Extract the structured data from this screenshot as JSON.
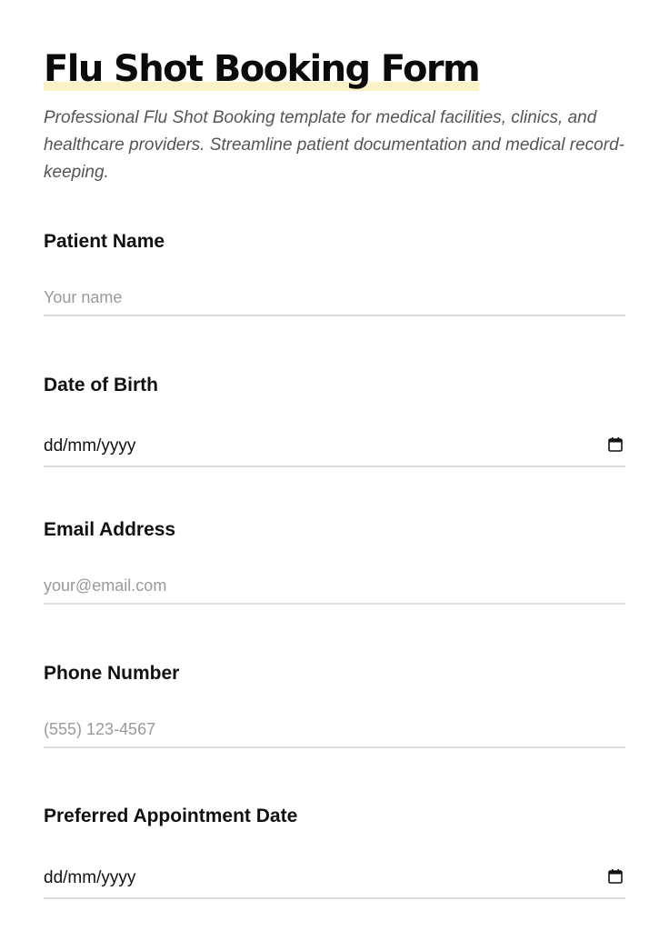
{
  "form": {
    "title": "Flu Shot Booking Form",
    "description": "Professional Flu Shot Booking template for medical facilities, clinics, and healthcare providers. Streamline patient documentation and medical record-keeping.",
    "highlight_color": "#fdf1c7",
    "fields": {
      "patient_name": {
        "label": "Patient Name",
        "placeholder": "Your name",
        "value": ""
      },
      "date_of_birth": {
        "label": "Date of Birth",
        "display_value": "dd/mm/yyyy",
        "icon": "calendar-icon"
      },
      "email": {
        "label": "Email Address",
        "placeholder": "your@email.com",
        "value": ""
      },
      "phone": {
        "label": "Phone Number",
        "placeholder": "(555) 123-4567",
        "value": ""
      },
      "appointment_date": {
        "label": "Preferred Appointment Date",
        "display_value": "dd/mm/yyyy",
        "icon": "calendar-icon"
      }
    }
  }
}
